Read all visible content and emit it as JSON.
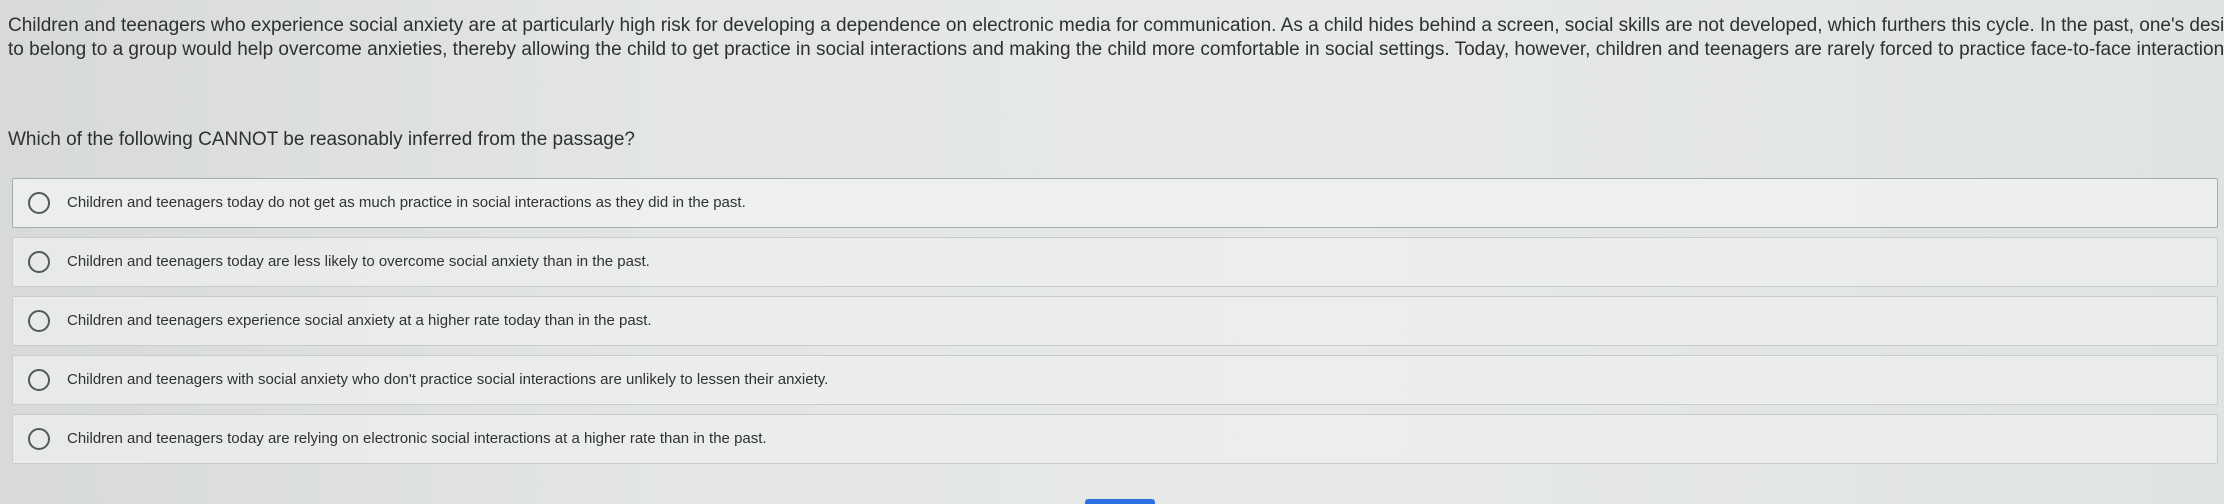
{
  "passage": {
    "line1": "Children and teenagers who experience social anxiety are at particularly high risk for developing a dependence on electronic media for communication. As a child hides behind a screen, social skills are not developed, which furthers this cycle. In the past, one's desire",
    "line2": "to belong to a group would help overcome anxieties, thereby allowing the child to get practice in social interactions and making the child more comfortable in social settings. Today, however, children and teenagers are rarely forced to practice face-to-face interactions."
  },
  "question": "Which of the following CANNOT be reasonably inferred from the passage?",
  "choices": [
    {
      "label": "Children and teenagers today do not get as much practice in social interactions as they did in the past.",
      "selected": false
    },
    {
      "label": "Children and teenagers today are less likely to overcome social anxiety than in the past.",
      "selected": false
    },
    {
      "label": "Children and teenagers experience social anxiety at a higher rate today than in the past.",
      "selected": false
    },
    {
      "label": "Children and teenagers with social anxiety who don't practice social interactions are unlikely to lessen their anxiety.",
      "selected": false
    },
    {
      "label": "Children and teenagers today are relying on electronic social interactions at a higher rate than in the past.",
      "selected": false
    }
  ],
  "colors": {
    "accent": "#2d6fe0",
    "text": "#2e3033",
    "radio_border": "#55595c"
  }
}
